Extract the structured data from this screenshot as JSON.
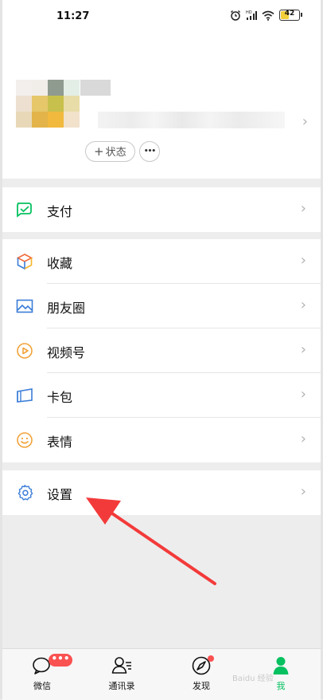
{
  "status_bar": {
    "time": "11:27",
    "battery_level": "42"
  },
  "profile": {
    "status_label": "状态",
    "more_glyph": "•••"
  },
  "menu_groups": [
    [
      {
        "label": "支付",
        "icon": "pay-icon",
        "color": "#07c160"
      }
    ],
    [
      {
        "label": "收藏",
        "icon": "favorites-cube-icon",
        "color": "#f7b52c"
      },
      {
        "label": "朋友圈",
        "icon": "moments-picture-icon",
        "color": "#3b7dd8"
      },
      {
        "label": "视频号",
        "icon": "channels-play-icon",
        "color": "#f2a33a"
      },
      {
        "label": "卡包",
        "icon": "card-wallet-icon",
        "color": "#3b7dd8"
      },
      {
        "label": "表情",
        "icon": "sticker-smile-icon",
        "color": "#f2a33a"
      }
    ],
    [
      {
        "label": "设置",
        "icon": "settings-gear-icon",
        "color": "#3b7dd8"
      }
    ]
  ],
  "tab_bar": {
    "tabs": [
      {
        "label": "微信",
        "icon": "chat-icon",
        "badge": "•••",
        "active": false
      },
      {
        "label": "通讯录",
        "icon": "contacts-icon",
        "active": false
      },
      {
        "label": "发现",
        "icon": "discover-compass-icon",
        "active": false,
        "dot": true
      },
      {
        "label": "我",
        "icon": "me-person-icon",
        "active": true
      }
    ],
    "active_color": "#07c160"
  },
  "annotation": {
    "color": "#f33a3a"
  },
  "watermark": "Baidu 经验"
}
